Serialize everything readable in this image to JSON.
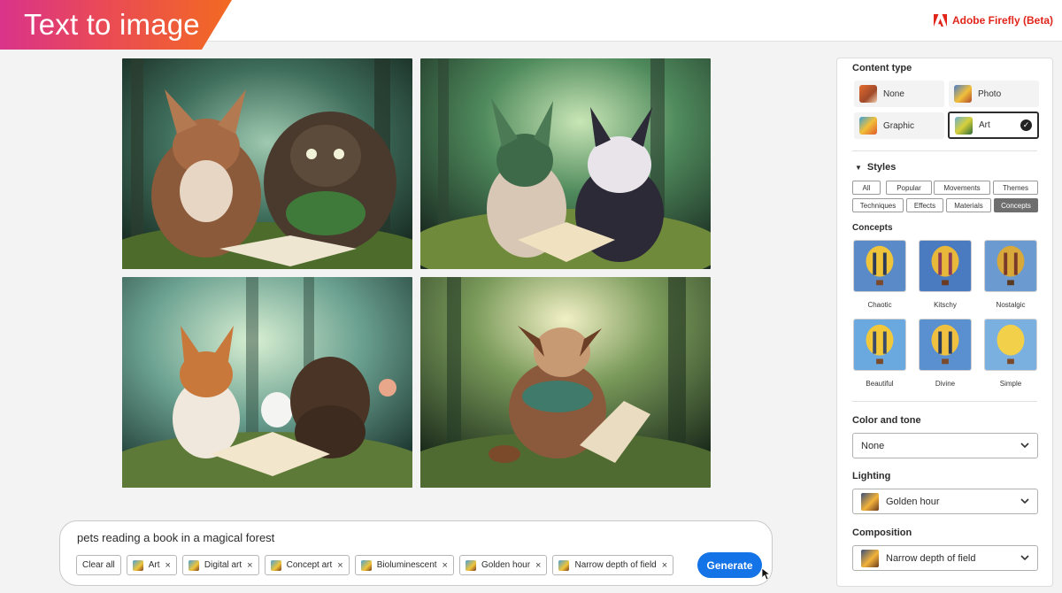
{
  "header": {
    "title": "Text to image",
    "brand": "Adobe Firefly (Beta)"
  },
  "prompt": {
    "text": "pets reading a book in a magical forest",
    "clear_label": "Clear all",
    "chips": [
      "Art",
      "Digital art",
      "Concept art",
      "Bioluminescent",
      "Golden hour",
      "Narrow depth of field"
    ],
    "remove_glyph": "×",
    "generate_label": "Generate"
  },
  "panel": {
    "content_type": {
      "title": "Content type",
      "options": [
        "None",
        "Photo",
        "Graphic",
        "Art"
      ],
      "selected": "Art"
    },
    "styles": {
      "title": "Styles",
      "tabs": [
        "All",
        "Popular",
        "Movements",
        "Themes",
        "Techniques",
        "Effects",
        "Materials",
        "Concepts"
      ],
      "active_tab": "Concepts",
      "section_label": "Concepts",
      "concepts": [
        "Chaotic",
        "Kitschy",
        "Nostalgic",
        "Beautiful",
        "Divine",
        "Simple"
      ]
    },
    "color_tone": {
      "title": "Color and tone",
      "value": "None"
    },
    "lighting": {
      "title": "Lighting",
      "value": "Golden hour"
    },
    "composition": {
      "title": "Composition",
      "value": "Narrow depth of field"
    }
  },
  "colors": {
    "accent": "#1473e6",
    "brand_red": "#e1251b",
    "banner_start": "#d9338b",
    "banner_end": "#f26a21"
  }
}
